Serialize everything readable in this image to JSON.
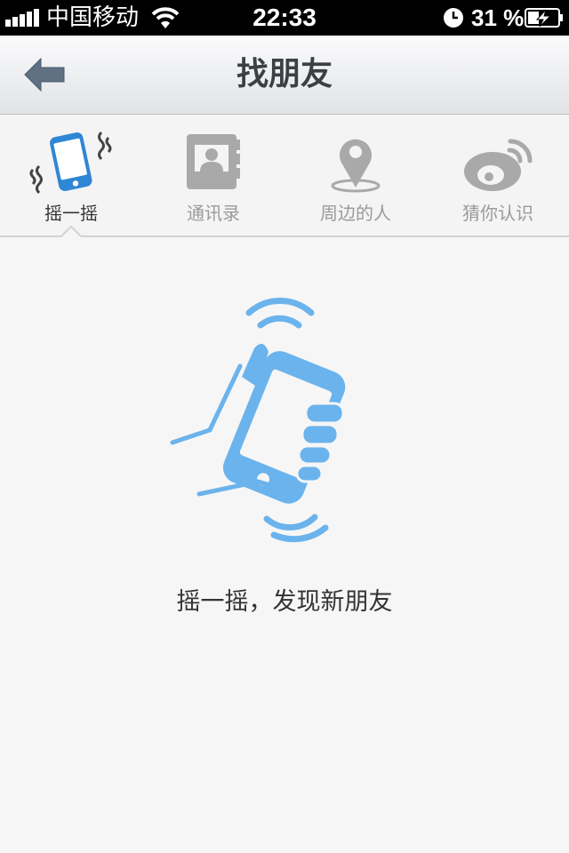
{
  "status_bar": {
    "carrier": "中国移动",
    "time": "22:33",
    "battery_percent": "31 %",
    "icons": [
      "signal-icon",
      "wifi-icon",
      "alarm-icon",
      "battery-charging-icon"
    ]
  },
  "nav": {
    "title": "找朋友",
    "back_icon": "back-arrow-icon"
  },
  "tabs": [
    {
      "label": "摇一摇",
      "icon": "shake-phone-icon",
      "active": true
    },
    {
      "label": "通讯录",
      "icon": "contacts-icon",
      "active": false
    },
    {
      "label": "周边的人",
      "icon": "location-pin-icon",
      "active": false
    },
    {
      "label": "猜你认识",
      "icon": "weibo-icon",
      "active": false
    }
  ],
  "main": {
    "illustration": "hand-shaking-phone-illustration",
    "caption": "摇一摇，发现新朋友"
  },
  "colors": {
    "accent_blue": "#2f86d4",
    "illustration_blue": "#6bb3ec",
    "inactive_gray": "#a9a9a9"
  }
}
